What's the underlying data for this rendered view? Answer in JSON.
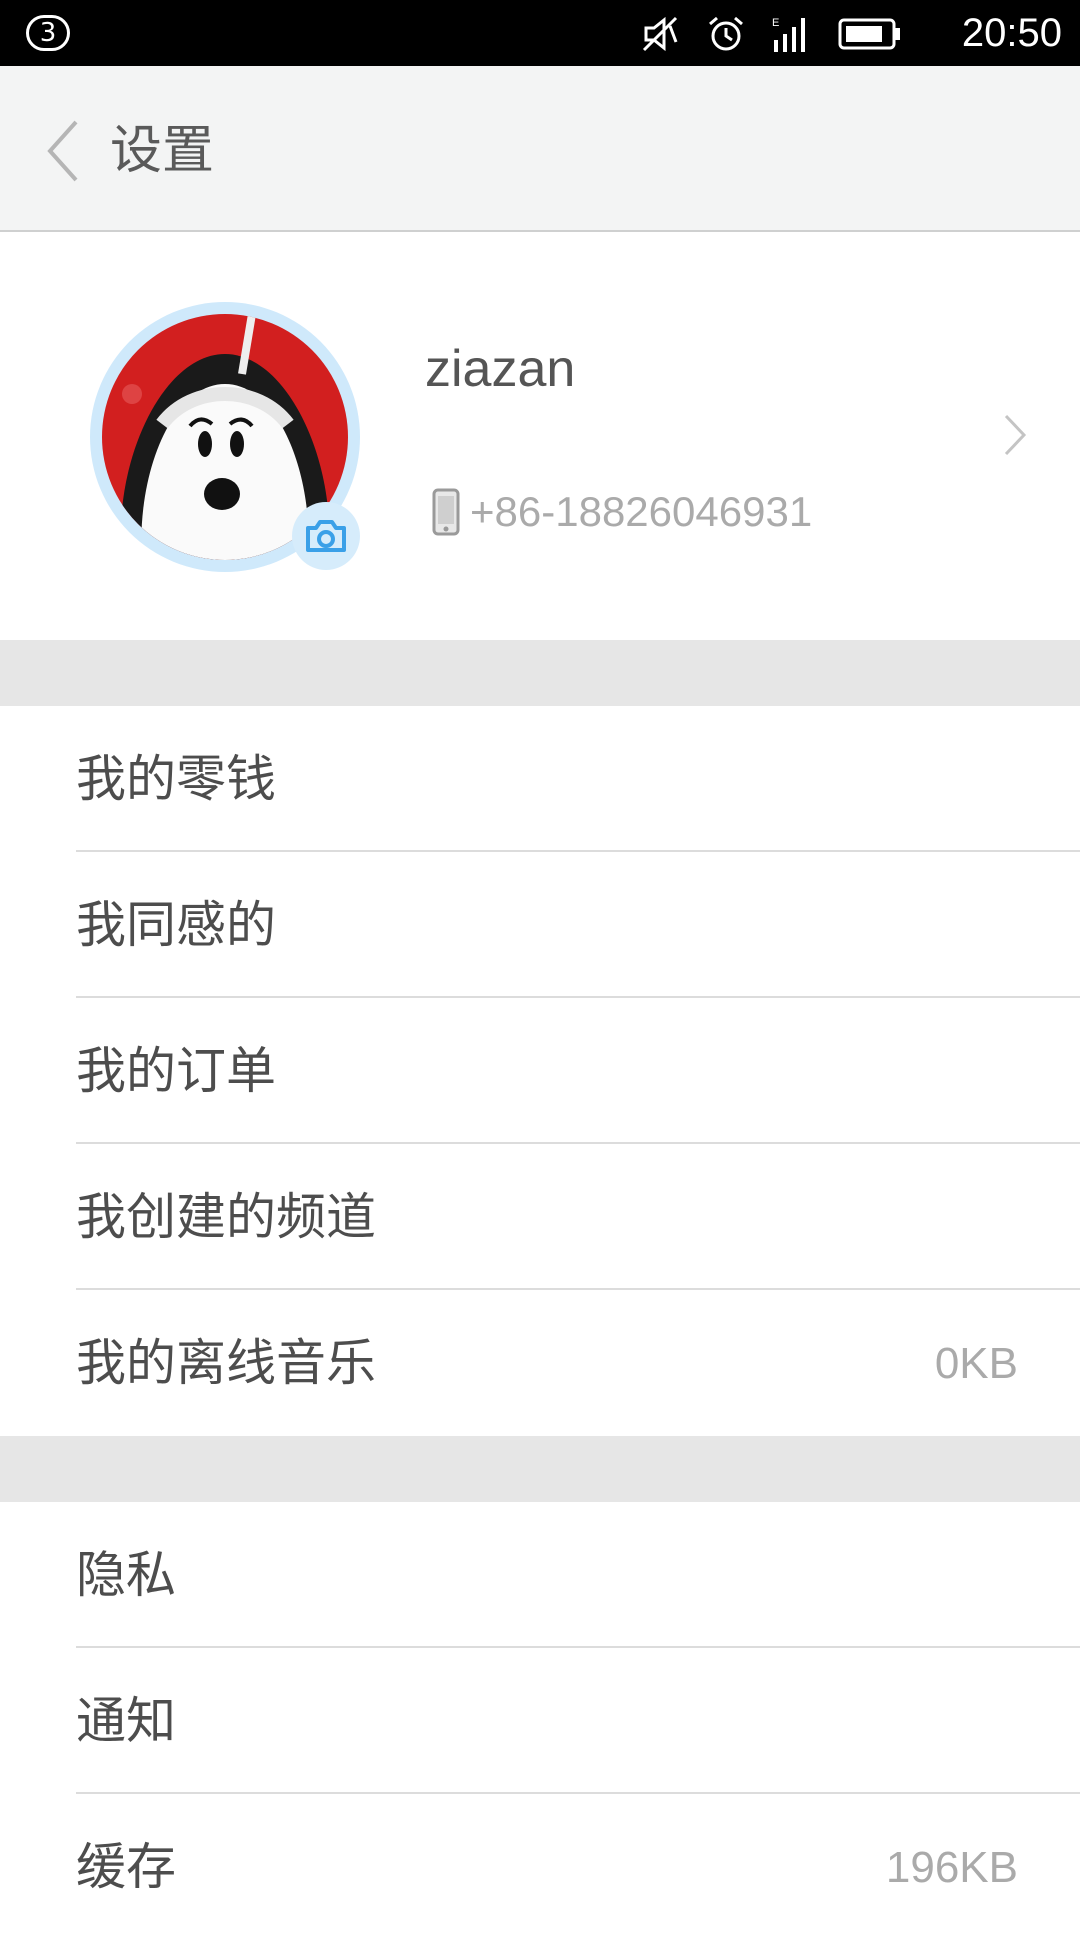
{
  "status_bar": {
    "notification_count": "3",
    "time": "20:50",
    "icons": [
      "mute-icon",
      "alarm-icon",
      "signal-icon",
      "battery-icon"
    ]
  },
  "header": {
    "title": "设置",
    "back_icon": "chevron-left-icon"
  },
  "profile": {
    "username": "ziazan",
    "phone": "+86-18826046931",
    "phone_icon": "mobile-phone-icon",
    "avatar_badge_icon": "camera-icon"
  },
  "section1": {
    "items": [
      {
        "label": "我的零钱",
        "value": ""
      },
      {
        "label": "我同感的",
        "value": ""
      },
      {
        "label": "我的订单",
        "value": ""
      },
      {
        "label": "我创建的频道",
        "value": ""
      },
      {
        "label": "我的离线音乐",
        "value": "0KB"
      }
    ]
  },
  "section2": {
    "items": [
      {
        "label": "隐私",
        "value": ""
      },
      {
        "label": "通知",
        "value": ""
      },
      {
        "label": "缓存",
        "value": "196KB"
      }
    ]
  },
  "colors": {
    "accent": "#3aa0e8",
    "avatar_bg": "#d21f1f",
    "section_gap": "#e6e6e6"
  }
}
